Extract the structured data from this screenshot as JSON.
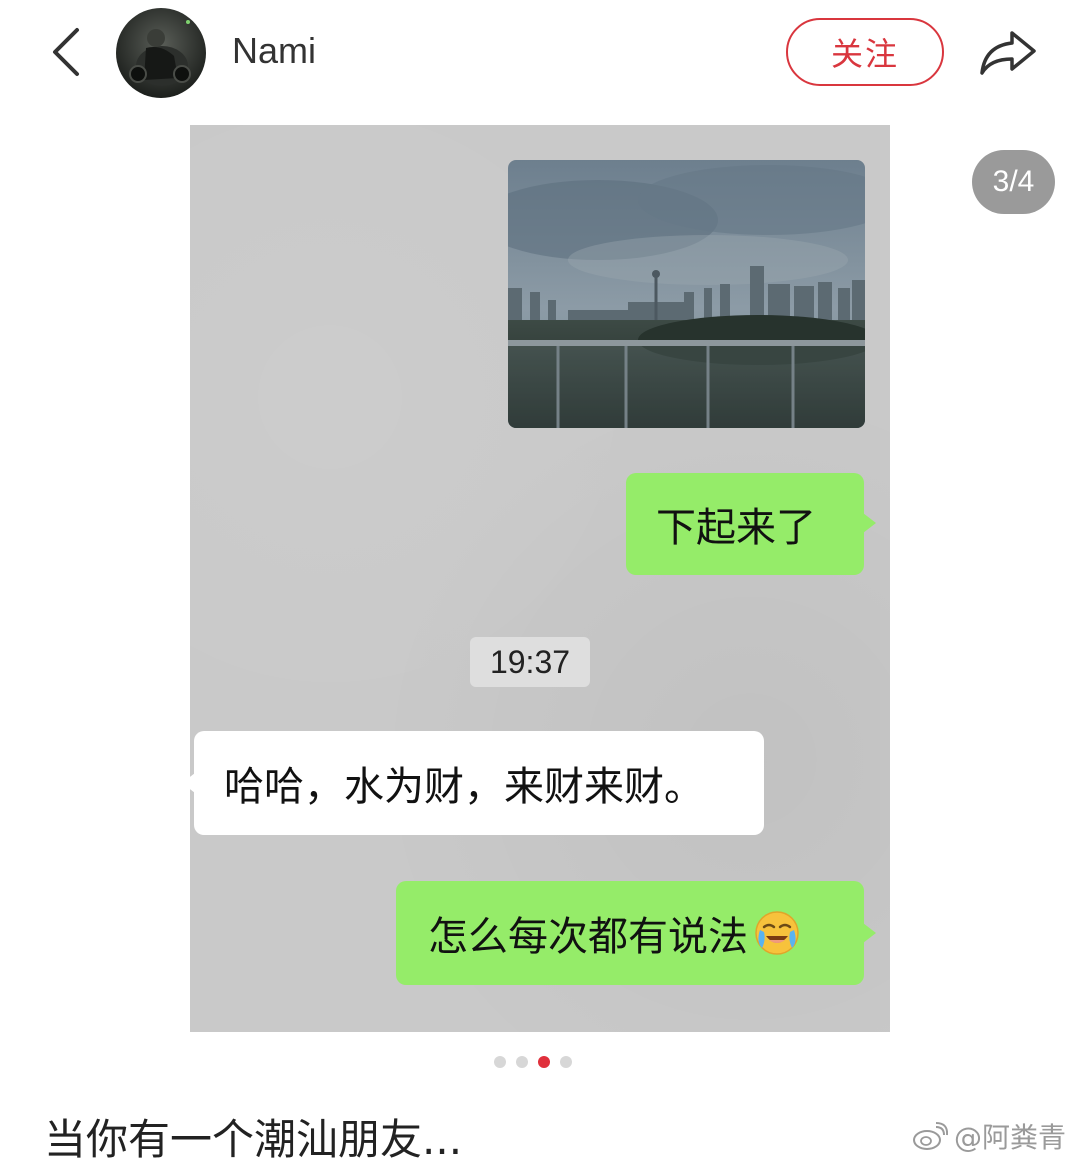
{
  "header": {
    "username": "Nami",
    "follow_label": "关注",
    "back_icon": "chevron-left-icon",
    "share_icon": "share-arrow-icon"
  },
  "gallery": {
    "counter": "3/4",
    "current_index": 3,
    "total": 4,
    "visible_dots": 4,
    "active_dot": 3
  },
  "chat": {
    "messages": [
      {
        "side": "right",
        "type": "image",
        "content": "city-skyline-rainy-photo"
      },
      {
        "side": "right",
        "type": "text",
        "text": "下起来了"
      },
      {
        "side": "center",
        "type": "time",
        "text": "19:37"
      },
      {
        "side": "left",
        "type": "text",
        "text": "哈哈，水为财，来财来财。"
      },
      {
        "side": "right",
        "type": "text",
        "text": "怎么每次都有说法",
        "emoji": "crying-laughing-emoji"
      }
    ]
  },
  "caption": "当你有一个潮汕朋友...",
  "watermark": "@阿粪青",
  "colors": {
    "accent": "#d9363e",
    "bubble_green": "#95ec69",
    "bubble_white": "#ffffff",
    "chat_background": "#c9c9c9",
    "dot_active": "#e0303c"
  }
}
